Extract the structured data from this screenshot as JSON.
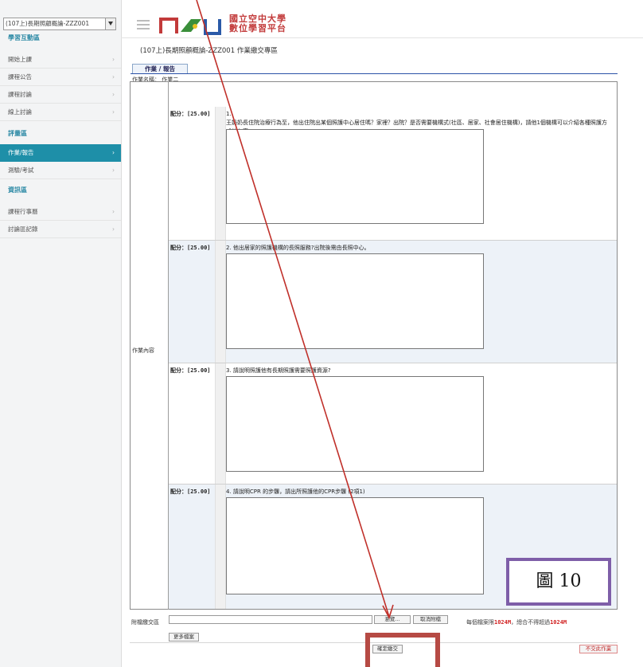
{
  "sidebar": {
    "course_select_value": "(107上)長期照顧概論-ZZZ001",
    "sections": [
      {
        "title": "學習互動區",
        "items": [
          {
            "label": "開始上課",
            "chevron": "›"
          },
          {
            "label": "課程公告",
            "chevron": "›"
          },
          {
            "label": "課程討論",
            "chevron": "›"
          },
          {
            "label": "線上討論",
            "chevron": "›"
          }
        ]
      },
      {
        "title": "評量區",
        "items": [
          {
            "label": "作業/報告",
            "chevron": "›",
            "active": true
          },
          {
            "label": "測驗/考試",
            "chevron": "›"
          }
        ]
      },
      {
        "title": "資訊區",
        "items": [
          {
            "label": "課程行事曆",
            "chevron": "›"
          },
          {
            "label": "討論區記錄",
            "chevron": "›"
          }
        ]
      }
    ]
  },
  "header": {
    "logo_line1": "國立空中大學",
    "logo_line2": "數位學習平台",
    "page_title": "(107上)長期照顧概論-ZZZ001 作業繳交專區"
  },
  "tab": {
    "label": "作業 / 報告"
  },
  "breadcrumb": "作業名稱： 作業二",
  "form": {
    "content_label": "作業內容",
    "questions": [
      {
        "score": "配分：[25.00]",
        "text": "1.\n王奶奶長住院治療行為至，他出住院出某個照護中心居住嗎？家裡？出院？是否需要機構式(社區、居家、社會居住機構)，請他1個機構可以介紹各種照護方式的內容。"
      },
      {
        "score": "配分：[25.00]",
        "text": "2. 他出居家的照護機構的長照服務?出院後需由長照中心。"
      },
      {
        "score": "配分：[25.00]",
        "text": "3. 請說明照護他有長期照護需要照護資源?"
      },
      {
        "score": "配分：[25.00]",
        "text": "4. 請說明CPR 的步驟，請出所照護他的CPR步驟 (2項1)"
      }
    ]
  },
  "attachment": {
    "label": "附檔繳交區",
    "browse_label": "瀏覽...",
    "cancel_label": "取消附檔",
    "more_label": "更多檔案",
    "limit_prefix": "每個檔案限",
    "limit_value": "1024M",
    "limit_mid": "，總合不得超過",
    "limit_total": "1024M"
  },
  "footer": {
    "confirm_label": "確定繳交",
    "dont_submit_label": "不交此作業"
  },
  "annotation": {
    "figure_label": "圖 10"
  },
  "icons": {
    "hamburger": "hamburger-menu-icon",
    "dropdown": "chevron-down-icon",
    "logo": "nou-logo-icon"
  },
  "colors": {
    "accent": "#1e8fa8",
    "logo_red": "#c23a3a",
    "annotation_arrow": "#c0302a",
    "figure_box": "#7e5ea8",
    "highlight_box": "#b64a44"
  }
}
